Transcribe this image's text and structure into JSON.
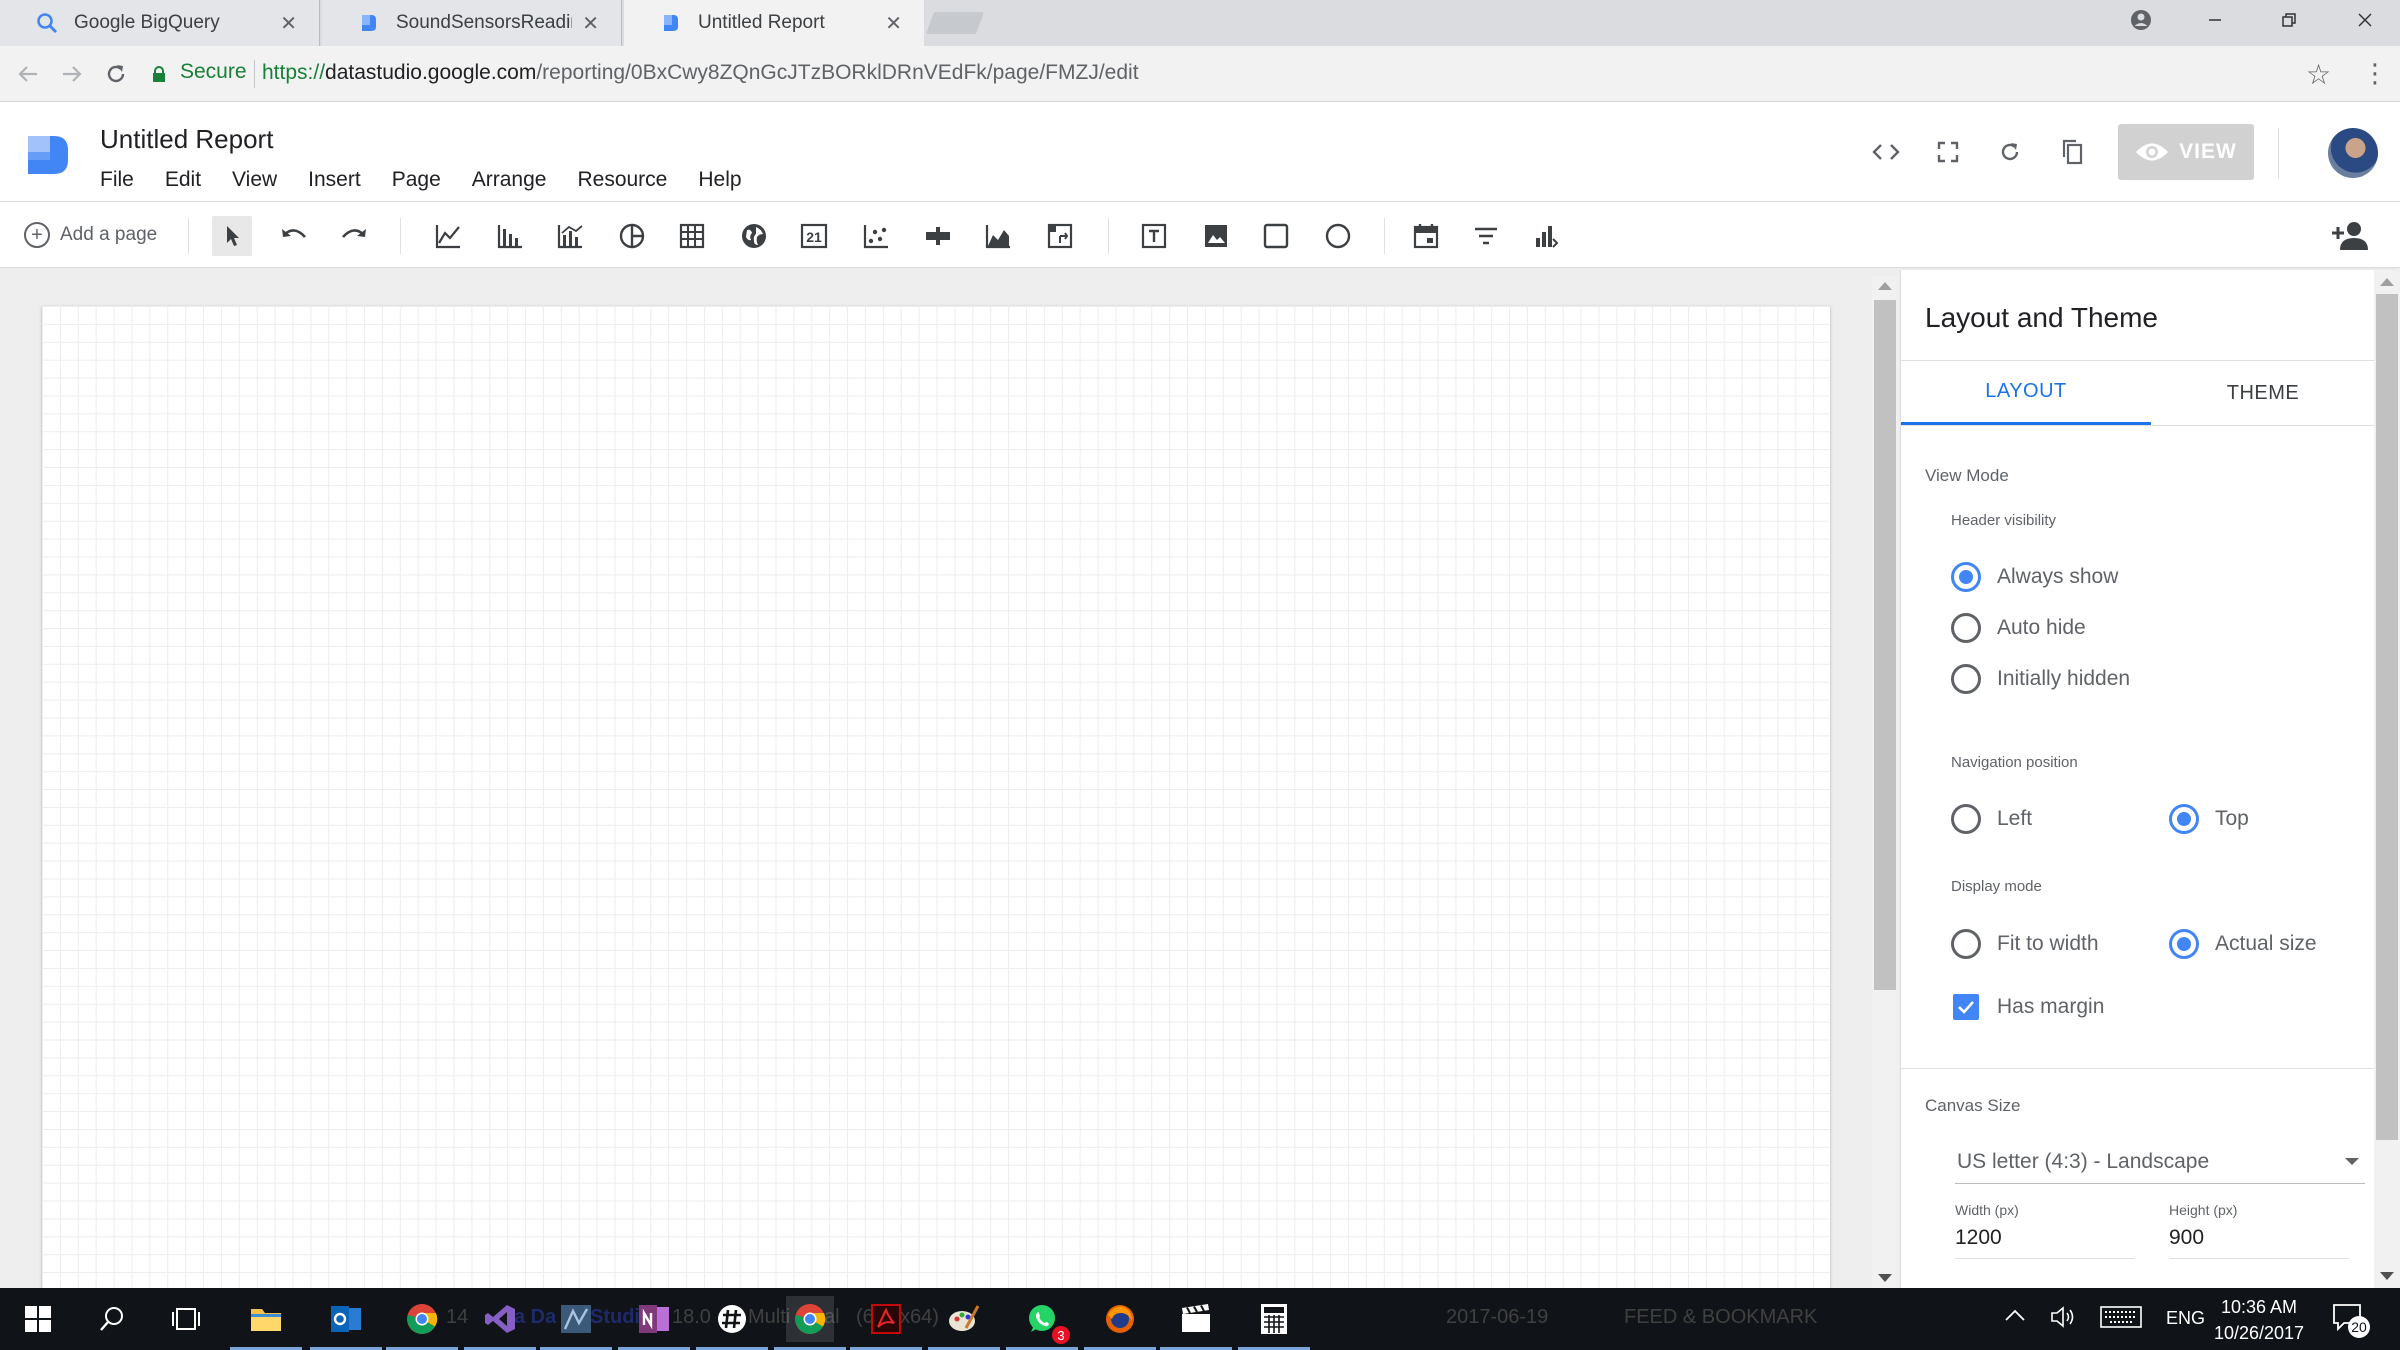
{
  "browser": {
    "tabs": [
      {
        "title": "Google BigQuery",
        "active": false
      },
      {
        "title": "SoundSensorsReadingTa",
        "active": false
      },
      {
        "title": "Untitled Report",
        "active": true
      }
    ],
    "secure_label": "Secure",
    "url_proto": "https://",
    "url_host": "datastudio.google.com",
    "url_path": "/reporting/0BxCwy8ZQnGcJTzBORklDRnVEdFk/page/FMZJ/edit"
  },
  "app": {
    "report_title": "Untitled Report",
    "menu": [
      "File",
      "Edit",
      "View",
      "Insert",
      "Page",
      "Arrange",
      "Resource",
      "Help"
    ],
    "view_button": "VIEW"
  },
  "toolbar": {
    "add_page": "Add a page",
    "icons": [
      "select-tool",
      "undo",
      "redo",
      "time-series-chart",
      "bar-chart",
      "combo-chart",
      "pie-chart",
      "table",
      "geo-map",
      "scorecard",
      "scatter-chart",
      "bullet-chart",
      "area-chart",
      "pivot-table",
      "text",
      "image",
      "rectangle",
      "circle",
      "date-range",
      "filter-control",
      "data-control"
    ]
  },
  "panel": {
    "title": "Layout and Theme",
    "tabs": [
      "LAYOUT",
      "THEME"
    ],
    "view_mode": "View Mode",
    "header_visibility": {
      "label": "Header visibility",
      "options": [
        "Always show",
        "Auto hide",
        "Initially hidden"
      ],
      "selected": "Always show"
    },
    "navigation_position": {
      "label": "Navigation position",
      "options": [
        "Left",
        "Top"
      ],
      "selected": "Top"
    },
    "display_mode": {
      "label": "Display mode",
      "options": [
        "Fit to width",
        "Actual size"
      ],
      "selected": "Actual size"
    },
    "has_margin": {
      "label": "Has margin",
      "checked": true
    },
    "canvas_size": {
      "label": "Canvas Size",
      "selected": "US letter (4:3) - Landscape",
      "width_label": "Width (px)",
      "width_value": "1200",
      "height_label": "Height (px)",
      "height_value": "900"
    }
  },
  "taskbar": {
    "ghost_texts": [
      "14",
      "a Da",
      "Studi",
      "18.0",
      "Multi",
      "al",
      "(6",
      "x64)",
      "2017-06-19",
      "FEED & BOOKMARK"
    ],
    "language": "ENG",
    "time": "10:36 AM",
    "date": "10/26/2017",
    "notification_count": "20",
    "whatsapp_badge": "3"
  },
  "colors": {
    "accent": "#1a73e8",
    "radio_on": "#4285f4",
    "secure_green": "#188038",
    "logo_blue": "#4285f4"
  }
}
